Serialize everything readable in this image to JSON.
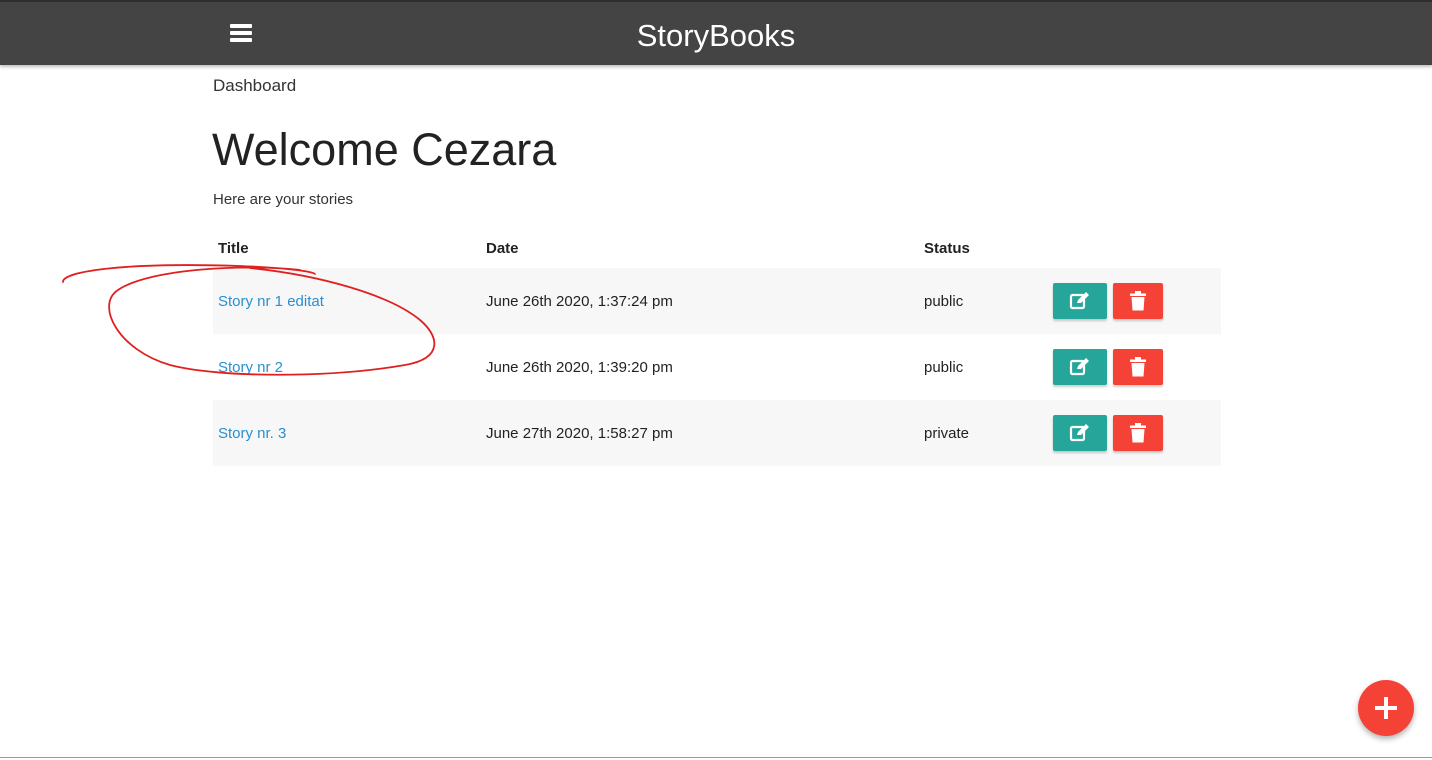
{
  "header": {
    "brand": "StoryBooks",
    "menu_icon": "hamburger-menu-icon",
    "background": "#444444"
  },
  "breadcrumb": "Dashboard",
  "page": {
    "title": "Welcome Cezara",
    "subtitle": "Here are your stories"
  },
  "table": {
    "columns": [
      "Title",
      "Date",
      "Status",
      ""
    ],
    "rows": [
      {
        "title": "Story nr 1 editat",
        "date": "June 26th 2020, 1:37:24 pm",
        "status": "public"
      },
      {
        "title": "Story nr 2",
        "date": "June 26th 2020, 1:39:20 pm",
        "status": "public"
      },
      {
        "title": "Story nr. 3",
        "date": "June 27th 2020, 1:58:27 pm",
        "status": "private"
      }
    ],
    "edit_icon": "edit-icon",
    "delete_icon": "trash-icon"
  },
  "fab": {
    "icon": "plus-icon"
  },
  "colors": {
    "link": "#2a8fd0",
    "edit_button": "#26a69a",
    "delete_button": "#f44336",
    "annotation": "#e02020"
  }
}
